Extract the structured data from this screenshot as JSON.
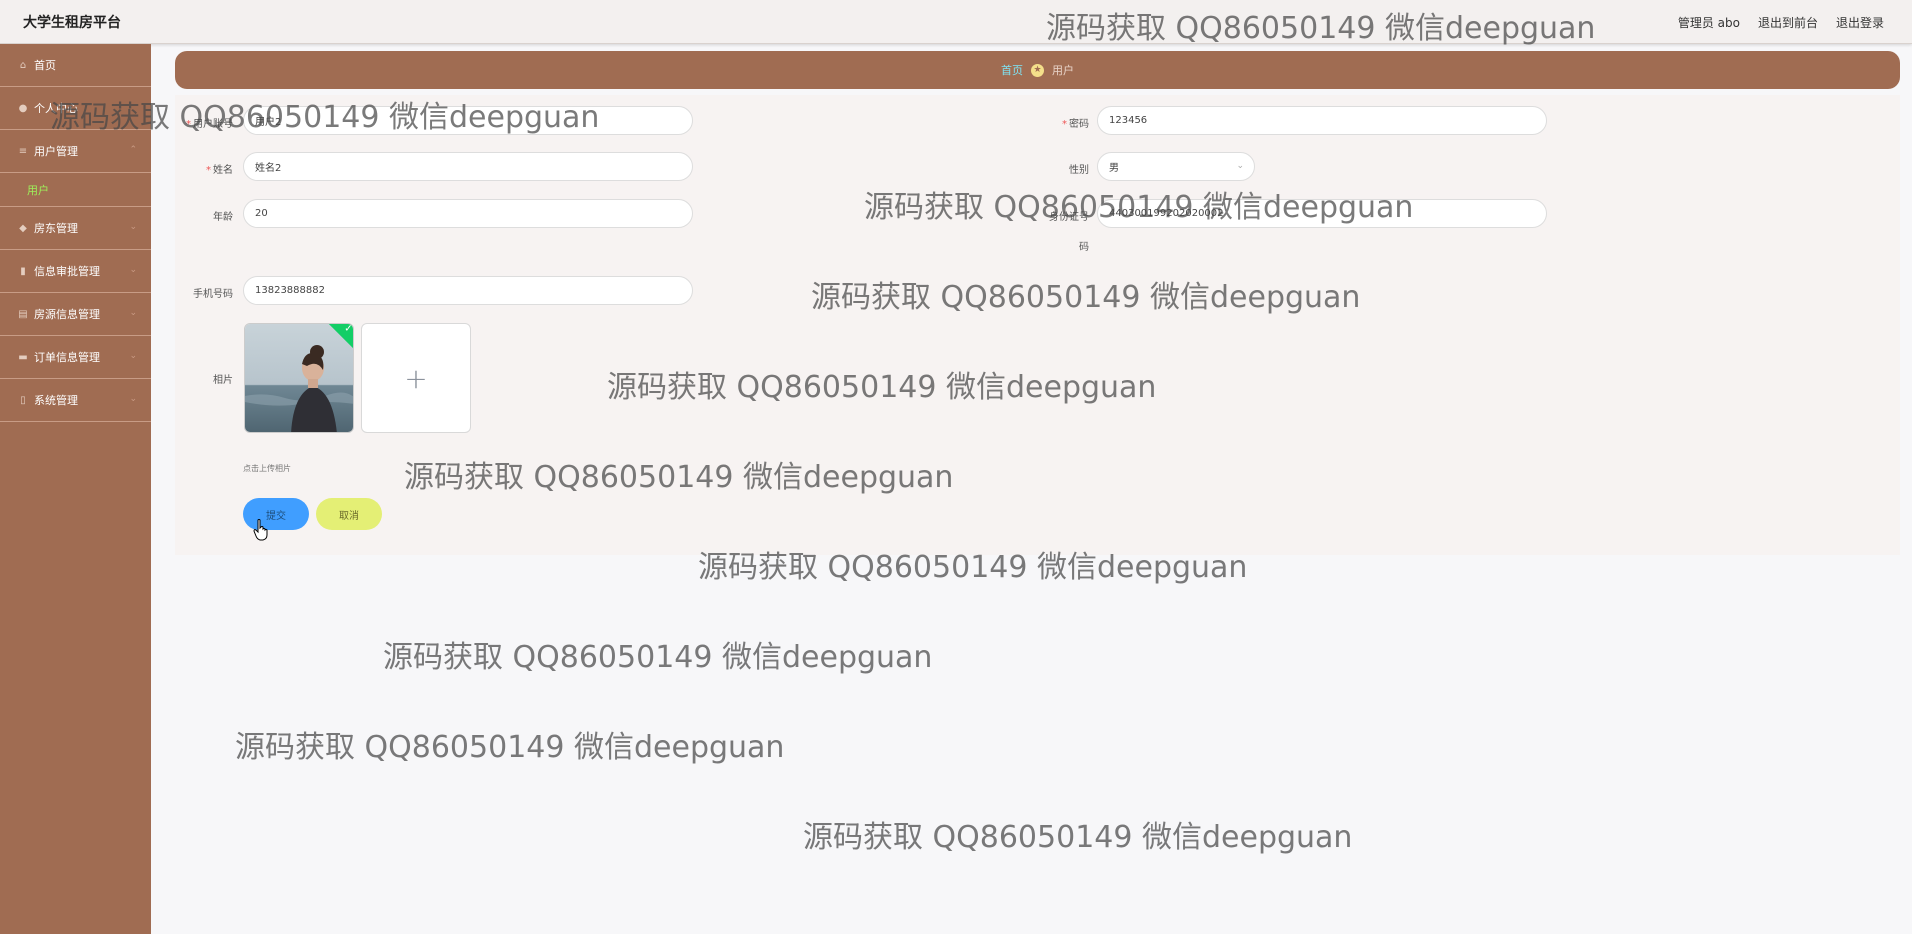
{
  "app": {
    "title": "大学生租房平台"
  },
  "topbar": {
    "user_label": "管理员 abo",
    "front_link": "退出到前台",
    "logout_link": "退出登录"
  },
  "sidebar": {
    "items": [
      {
        "label": "首页",
        "icon": "home-icon"
      },
      {
        "label": "个人中心",
        "icon": "user-icon"
      },
      {
        "label": "用户管理",
        "icon": "list-icon"
      },
      {
        "label": "用户",
        "icon": ""
      },
      {
        "label": "房东管理",
        "icon": "shield-icon"
      },
      {
        "label": "信息审批管理",
        "icon": "chart-icon"
      },
      {
        "label": "房源信息管理",
        "icon": "doc-icon"
      },
      {
        "label": "订单信息管理",
        "icon": "order-icon"
      },
      {
        "label": "系统管理",
        "icon": "settings-icon"
      }
    ]
  },
  "breadcrumb": {
    "home": "首页",
    "current": "用户"
  },
  "form": {
    "account": {
      "label": "用户账号",
      "value": "用户2"
    },
    "password": {
      "label": "密码",
      "value": "123456"
    },
    "name": {
      "label": "姓名",
      "value": "姓名2"
    },
    "gender": {
      "label": "性别",
      "value": "男"
    },
    "age": {
      "label": "年龄",
      "value": "20"
    },
    "idcard": {
      "label_line1": "身份证号",
      "label_line2": "码",
      "value": "440300199202020002"
    },
    "phone": {
      "label": "手机号码",
      "value": "13823888882"
    },
    "photo": {
      "label": "相片",
      "upload_tip": "点击上传相片",
      "plus": "+"
    },
    "submit_label": "提交",
    "cancel_label": "取消"
  },
  "watermark": {
    "text": "源码获取 QQ86050149 微信deepguan"
  }
}
